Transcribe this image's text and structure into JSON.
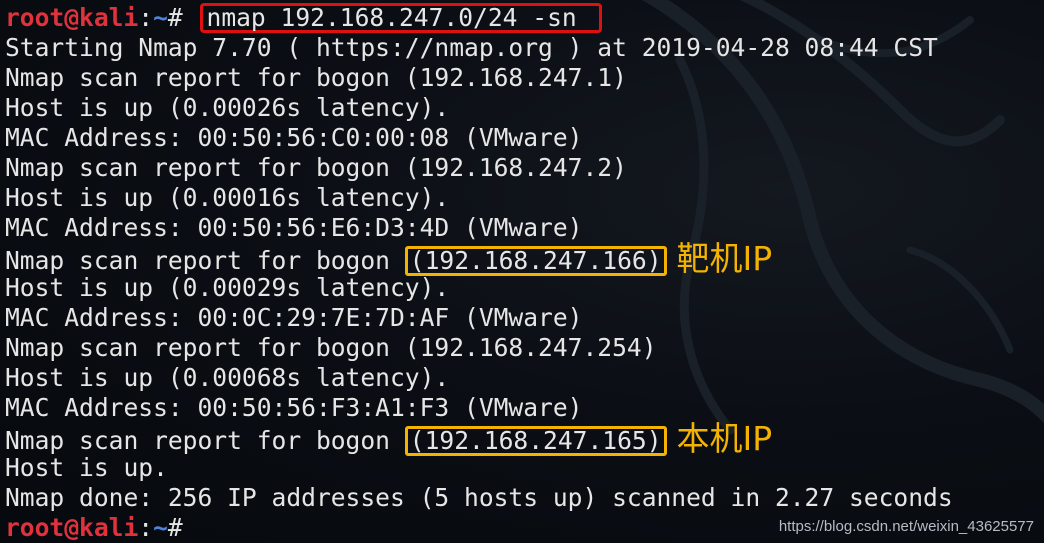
{
  "prompt": {
    "user_host": "root@kali",
    "sep": ":",
    "path": "~",
    "hash": "#"
  },
  "command": "nmap 192.168.247.0/24 -sn",
  "output": {
    "starting": "Starting Nmap 7.70 ( https://nmap.org ) at 2019-04-28 08:44 CST",
    "report_prefix": "Nmap scan report for bogon ",
    "hosts": [
      {
        "ip": "(192.168.247.1)",
        "status": "Host is up (0.00026s latency).",
        "mac": "MAC Address: 00:50:56:C0:00:08 (VMware)"
      },
      {
        "ip": "(192.168.247.2)",
        "status": "Host is up (0.00016s latency).",
        "mac": "MAC Address: 00:50:56:E6:D3:4D (VMware)"
      },
      {
        "ip": "(192.168.247.166)",
        "status": "Host is up (0.00029s latency).",
        "mac": "MAC Address: 00:0C:29:7E:7D:AF (VMware)",
        "annotation": "靶机IP"
      },
      {
        "ip": "(192.168.247.254)",
        "status": "Host is up (0.00068s latency).",
        "mac": "MAC Address: 00:50:56:F3:A1:F3 (VMware)"
      },
      {
        "ip": "(192.168.247.165)",
        "status": "Host is up.",
        "annotation": "本机IP"
      }
    ],
    "done": "Nmap done: 256 IP addresses (5 hosts up) scanned in 2.27 seconds"
  },
  "highlight_colors": {
    "command_box": "#e01010",
    "ip_box": "#f5b301"
  },
  "watermark": "https://blog.csdn.net/weixin_43625577"
}
